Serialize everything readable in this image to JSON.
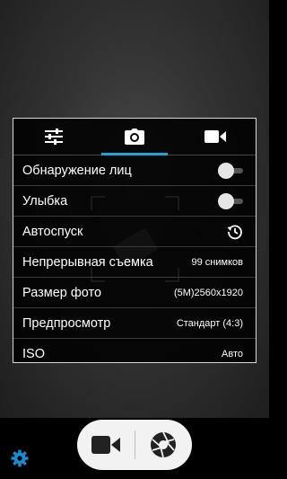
{
  "tabs": [
    {
      "icon": "sliders-icon",
      "active": false
    },
    {
      "icon": "camera-icon",
      "active": true
    },
    {
      "icon": "video-camera-icon",
      "active": false
    }
  ],
  "settings": {
    "face_detection": {
      "label": "Обнаружение лиц",
      "enabled": false
    },
    "smile": {
      "label": "Улыбка",
      "enabled": false
    },
    "self_timer": {
      "label": "Автоспуск",
      "icon": "timer-icon"
    },
    "burst": {
      "label": "Непрерывная съемка",
      "value": "99 снимков"
    },
    "photo_size": {
      "label": "Размер фото",
      "value": "(5M)2560x1920"
    },
    "preview": {
      "label": "Предпросмотр",
      "value": "Стандарт (4:3)"
    },
    "iso": {
      "label": "ISO",
      "value": "Авто"
    }
  },
  "controls": {
    "video_icon": "video-camera-icon",
    "shutter_icon": "aperture-icon",
    "settings_icon": "gear-icon"
  },
  "colors": {
    "accent": "#1ba7d6",
    "panel_border": "#d8d8d8",
    "shutter_bg": "#f2f2f2",
    "gear": "#1e88c9"
  }
}
